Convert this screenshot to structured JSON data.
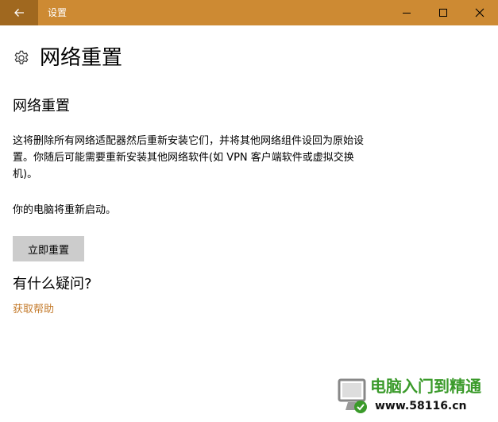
{
  "titlebar": {
    "title": "设置",
    "back_icon": "arrow-left-icon",
    "controls": [
      "minimize-icon",
      "maximize-icon",
      "close-icon"
    ],
    "accent_color": "#cd8a33"
  },
  "header": {
    "icon": "gear-icon",
    "title": "网络重置"
  },
  "main": {
    "section_title": "网络重置",
    "description": "这将删除所有网络适配器然后重新安装它们，并将其他网络组件设回为原始设置。你随后可能需要重新安装其他网络软件(如 VPN 客户端软件或虚拟交换机)。",
    "restart_note": "你的电脑将重新启动。",
    "reset_button_label": "立即重置"
  },
  "help": {
    "question": "有什么疑问?",
    "link_label": "获取帮助",
    "link_color": "#c47b2c"
  },
  "watermark": {
    "title": "电脑入门到精通",
    "url": "www.58116.cn"
  }
}
